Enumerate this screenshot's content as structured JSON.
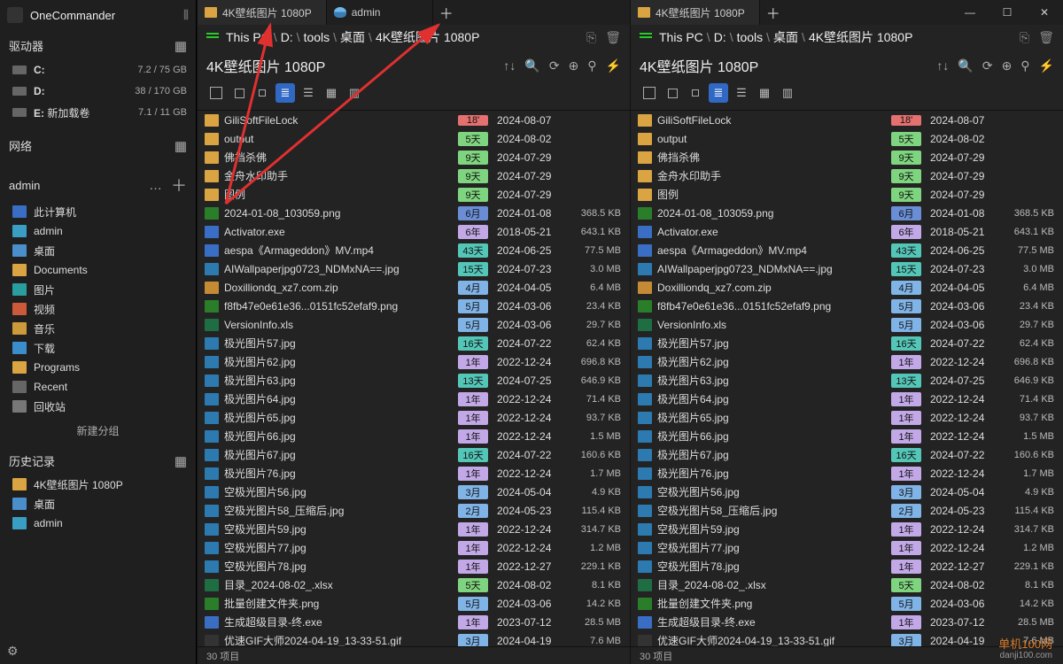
{
  "app": {
    "title": "OneCommander"
  },
  "win": {
    "min": "—",
    "max": "☐",
    "close": "✕"
  },
  "sidebar": {
    "drivesHead": "驱动器",
    "drives": [
      {
        "name": "C:",
        "label": "",
        "size": "7.2 / 75 GB"
      },
      {
        "name": "D:",
        "label": "",
        "size": "38 / 170 GB"
      },
      {
        "name": "E:",
        "label": "新加载卷",
        "size": "7.1 / 11 GB"
      }
    ],
    "networkHead": "网络",
    "adminHead": "admin",
    "adminItems": [
      {
        "label": "此计算机",
        "cls": "ii-pc"
      },
      {
        "label": "admin",
        "cls": "ii-user"
      },
      {
        "label": "桌面",
        "cls": "ii-desk"
      },
      {
        "label": "Documents",
        "cls": "ii-doc"
      },
      {
        "label": "图片",
        "cls": "ii-pic"
      },
      {
        "label": "视频",
        "cls": "ii-vid"
      },
      {
        "label": "音乐",
        "cls": "ii-music"
      },
      {
        "label": "下载",
        "cls": "ii-dl"
      },
      {
        "label": "Programs",
        "cls": "ii-prog"
      },
      {
        "label": "Recent",
        "cls": "ii-recent"
      },
      {
        "label": "回收站",
        "cls": "ii-trash"
      }
    ],
    "newGroup": "新建分组",
    "historyHead": "历史记录",
    "history": [
      {
        "label": "4K壁纸图片 1080P",
        "cls": "ii-doc"
      },
      {
        "label": "桌面",
        "cls": "ii-desk"
      },
      {
        "label": "admin",
        "cls": "ii-user"
      }
    ]
  },
  "panes": [
    {
      "tabs": [
        {
          "label": "4K壁纸图片 1080P",
          "kind": "folder",
          "active": true
        },
        {
          "label": "admin",
          "kind": "user",
          "active": false
        }
      ]
    },
    {
      "tabs": [
        {
          "label": "4K壁纸图片 1080P",
          "kind": "folder",
          "active": true
        }
      ]
    }
  ],
  "breadcrumb": [
    "This PC",
    "D:",
    "tools",
    "桌面",
    "4K壁纸图片 1080P"
  ],
  "folderName": "4K壁纸图片 1080P",
  "rows": [
    {
      "icon": "ic-folder",
      "name": "GiliSoftFileLock",
      "age": "18'",
      "ac": "a-red",
      "date": "2024-08-07",
      "size": ""
    },
    {
      "icon": "ic-folder",
      "name": "output",
      "age": "5天",
      "ac": "a-green",
      "date": "2024-08-02",
      "size": ""
    },
    {
      "icon": "ic-folder",
      "name": "佛挡杀佛",
      "age": "9天",
      "ac": "a-green",
      "date": "2024-07-29",
      "size": ""
    },
    {
      "icon": "ic-folder",
      "name": "金舟水印助手",
      "age": "9天",
      "ac": "a-green",
      "date": "2024-07-29",
      "size": ""
    },
    {
      "icon": "ic-folder",
      "name": "图例",
      "age": "9天",
      "ac": "a-green",
      "date": "2024-07-29",
      "size": ""
    },
    {
      "icon": "ic-png",
      "name": "2024-01-08_103059.png",
      "age": "6月",
      "ac": "a-blue",
      "date": "2024-01-08",
      "size": "368.5 KB"
    },
    {
      "icon": "ic-exe",
      "name": "Activator.exe",
      "age": "6年",
      "ac": "a-lav",
      "date": "2018-05-21",
      "size": "643.1 KB"
    },
    {
      "icon": "ic-mp4",
      "name": "aespa《Armageddon》MV.mp4",
      "age": "43天",
      "ac": "a-teal",
      "date": "2024-06-25",
      "size": "77.5 MB"
    },
    {
      "icon": "ic-jpg",
      "name": "AIWallpaperjpg0723_NDMxNA==.jpg",
      "age": "15天",
      "ac": "a-teal",
      "date": "2024-07-23",
      "size": "3.0 MB"
    },
    {
      "icon": "ic-zip",
      "name": "Doxilliondq_xz7.com.zip",
      "age": "4月",
      "ac": "a-ltblue",
      "date": "2024-04-05",
      "size": "6.4 MB"
    },
    {
      "icon": "ic-png",
      "name": "f8fb47e0e61e36...0151fc52efaf9.png",
      "age": "5月",
      "ac": "a-ltblue",
      "date": "2024-03-06",
      "size": "23.4 KB"
    },
    {
      "icon": "ic-xls",
      "name": "VersionInfo.xls",
      "age": "5月",
      "ac": "a-ltblue",
      "date": "2024-03-06",
      "size": "29.7 KB"
    },
    {
      "icon": "ic-jpg",
      "name": "极光图片57.jpg",
      "age": "16天",
      "ac": "a-teal",
      "date": "2024-07-22",
      "size": "62.4 KB"
    },
    {
      "icon": "ic-jpg",
      "name": "极光图片62.jpg",
      "age": "1年",
      "ac": "a-lav",
      "date": "2022-12-24",
      "size": "696.8 KB"
    },
    {
      "icon": "ic-jpg",
      "name": "极光图片63.jpg",
      "age": "13天",
      "ac": "a-teal",
      "date": "2024-07-25",
      "size": "646.9 KB"
    },
    {
      "icon": "ic-jpg",
      "name": "极光图片64.jpg",
      "age": "1年",
      "ac": "a-lav",
      "date": "2022-12-24",
      "size": "71.4 KB"
    },
    {
      "icon": "ic-jpg",
      "name": "极光图片65.jpg",
      "age": "1年",
      "ac": "a-lav",
      "date": "2022-12-24",
      "size": "93.7 KB"
    },
    {
      "icon": "ic-jpg",
      "name": "极光图片66.jpg",
      "age": "1年",
      "ac": "a-lav",
      "date": "2022-12-24",
      "size": "1.5 MB"
    },
    {
      "icon": "ic-jpg",
      "name": "极光图片67.jpg",
      "age": "16天",
      "ac": "a-teal",
      "date": "2024-07-22",
      "size": "160.6 KB"
    },
    {
      "icon": "ic-jpg",
      "name": "极光图片76.jpg",
      "age": "1年",
      "ac": "a-lav",
      "date": "2022-12-24",
      "size": "1.7 MB"
    },
    {
      "icon": "ic-jpg",
      "name": "空极光图片56.jpg",
      "age": "3月",
      "ac": "a-ltblue",
      "date": "2024-05-04",
      "size": "4.9 KB"
    },
    {
      "icon": "ic-jpg",
      "name": "空极光图片58_压缩后.jpg",
      "age": "2月",
      "ac": "a-ltblue",
      "date": "2024-05-23",
      "size": "115.4 KB"
    },
    {
      "icon": "ic-jpg",
      "name": "空极光图片59.jpg",
      "age": "1年",
      "ac": "a-lav",
      "date": "2022-12-24",
      "size": "314.7 KB"
    },
    {
      "icon": "ic-jpg",
      "name": "空极光图片77.jpg",
      "age": "1年",
      "ac": "a-lav",
      "date": "2022-12-24",
      "size": "1.2 MB"
    },
    {
      "icon": "ic-jpg",
      "name": "空极光图片78.jpg",
      "age": "1年",
      "ac": "a-lav",
      "date": "2022-12-27",
      "size": "229.1 KB"
    },
    {
      "icon": "ic-xls",
      "name": "目录_2024-08-02_.xlsx",
      "age": "5天",
      "ac": "a-green",
      "date": "2024-08-02",
      "size": "8.1 KB"
    },
    {
      "icon": "ic-png",
      "name": "批量创建文件夹.png",
      "age": "5月",
      "ac": "a-ltblue",
      "date": "2024-03-06",
      "size": "14.2 KB"
    },
    {
      "icon": "ic-exe",
      "name": "生成超级目录-终.exe",
      "age": "1年",
      "ac": "a-lav",
      "date": "2023-07-12",
      "size": "28.5 MB"
    },
    {
      "icon": "ic-gif",
      "name": "优速GIF大师2024-04-19_13-33-51.gif",
      "age": "3月",
      "ac": "a-ltblue",
      "date": "2024-04-19",
      "size": "7.6 MB"
    }
  ],
  "status": "30 项目",
  "watermark": {
    "l1": "单机100网",
    "l2": "danji100.com"
  }
}
